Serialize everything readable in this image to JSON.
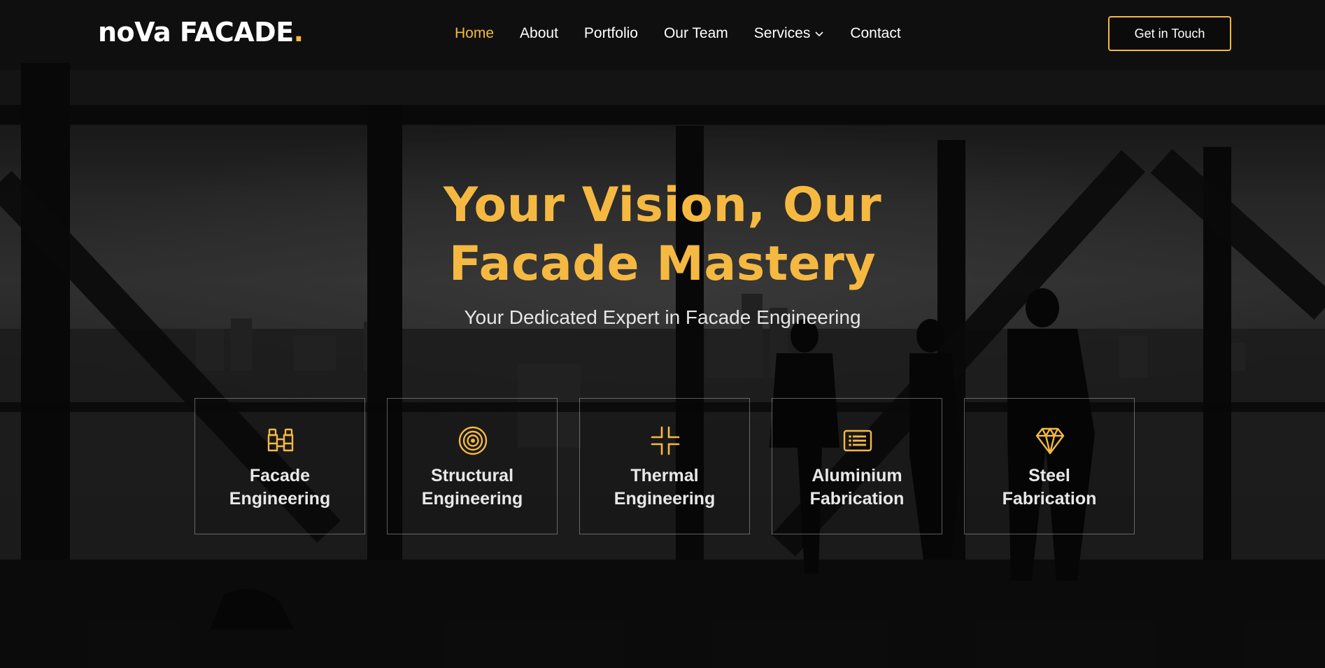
{
  "header": {
    "logo_main": "noVa FACADE",
    "logo_dot": ".",
    "nav": [
      {
        "label": "Home",
        "active": true
      },
      {
        "label": "About"
      },
      {
        "label": "Portfolio"
      },
      {
        "label": "Our Team"
      },
      {
        "label": "Services",
        "has_dropdown": true
      },
      {
        "label": "Contact"
      }
    ],
    "cta_label": "Get in Touch"
  },
  "hero": {
    "headline_line1": "Your Vision, Our",
    "headline_line2": "Facade Mastery",
    "subtitle": "Your Dedicated Expert in Facade Engineering"
  },
  "services": [
    {
      "line1": "Facade",
      "line2": "Engineering",
      "icon": "binoculars-icon"
    },
    {
      "line1": "Structural",
      "line2": "Engineering",
      "icon": "target-icon"
    },
    {
      "line1": "Thermal",
      "line2": "Engineering",
      "icon": "compress-icon"
    },
    {
      "line1": "Aluminium",
      "line2": "Fabrication",
      "icon": "list-card-icon"
    },
    {
      "line1": "Steel",
      "line2": "Fabrication",
      "icon": "gem-icon"
    }
  ],
  "colors": {
    "accent": "#f5b942",
    "text": "#ffffff",
    "background": "#1b1b1b"
  }
}
